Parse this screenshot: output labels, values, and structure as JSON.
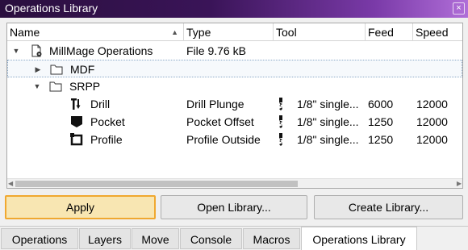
{
  "window": {
    "title": "Operations Library",
    "close_glyph": "×"
  },
  "columns": [
    {
      "label": "Name"
    },
    {
      "label": "Type"
    },
    {
      "label": "Tool"
    },
    {
      "label": "Feed"
    },
    {
      "label": "Speed"
    }
  ],
  "rows": [
    {
      "name": "MillMage Operations",
      "type": "File 9.76 kB",
      "icon": "library-file-icon",
      "expanded": true
    },
    {
      "name": "MDF",
      "icon": "folder-icon",
      "expanded": false,
      "selected": true
    },
    {
      "name": "SRPP",
      "icon": "folder-icon",
      "expanded": true
    },
    {
      "name": "Drill",
      "type": "Drill Plunge",
      "tool": "1/8\" single...",
      "feed": "6000",
      "speed": "12000",
      "icon": "drill-op-icon",
      "tool_icon": "endmill-icon"
    },
    {
      "name": "Pocket",
      "type": "Pocket Offset",
      "tool": "1/8\" single...",
      "feed": "1250",
      "speed": "12000",
      "icon": "pocket-op-icon",
      "tool_icon": "endmill-icon"
    },
    {
      "name": "Profile",
      "type": "Profile Outside",
      "tool": "1/8\" single...",
      "feed": "1250",
      "speed": "12000",
      "icon": "profile-op-icon",
      "tool_icon": "endmill-icon"
    }
  ],
  "buttons": {
    "apply": "Apply",
    "open_library": "Open Library...",
    "create_library": "Create Library..."
  },
  "tabs": [
    {
      "label": "Operations"
    },
    {
      "label": "Layers"
    },
    {
      "label": "Move"
    },
    {
      "label": "Console"
    },
    {
      "label": "Macros"
    },
    {
      "label": "Operations Library",
      "active": true
    }
  ],
  "colors": {
    "title_gradient_start": "#2a0f3e",
    "title_gradient_end": "#b06ed8",
    "apply_highlight": "#f0a830"
  }
}
